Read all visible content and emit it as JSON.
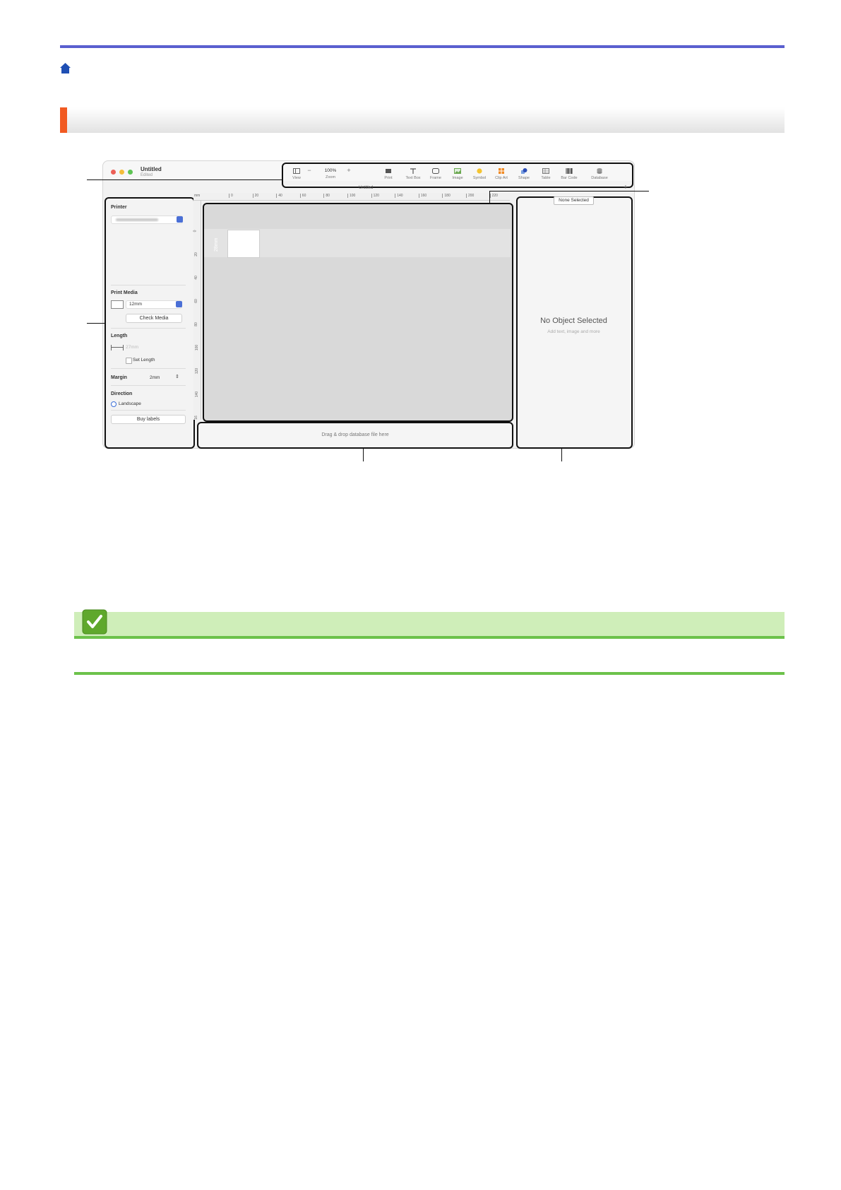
{
  "window": {
    "title": "Untitled",
    "subtitle": "Edited",
    "doc_tab": "Untitled",
    "plus": "+"
  },
  "toolbar": [
    {
      "name": "view",
      "label": "View"
    },
    {
      "name": "zoom-out",
      "label": "−"
    },
    {
      "name": "zoom",
      "label": "Zoom",
      "value": "100%"
    },
    {
      "name": "zoom-in",
      "label": "+"
    },
    {
      "name": "print",
      "label": "Print"
    },
    {
      "name": "text-box",
      "label": "Text Box"
    },
    {
      "name": "frame",
      "label": "Frame"
    },
    {
      "name": "image",
      "label": "Image"
    },
    {
      "name": "symbol",
      "label": "Symbol"
    },
    {
      "name": "clip-art",
      "label": "Clip Art"
    },
    {
      "name": "shape",
      "label": "Shape"
    },
    {
      "name": "table",
      "label": "Table"
    },
    {
      "name": "bar-code",
      "label": "Bar Code"
    },
    {
      "name": "database",
      "label": "Database"
    }
  ],
  "left_panel": {
    "printer_label": "Printer",
    "print_media_label": "Print Media",
    "media_value": "12mm",
    "check_media": "Check Media",
    "length_label": "Length",
    "length_value": "27mm",
    "set_length": "Set Length",
    "margin_label": "Margin",
    "margin_value": "2mm",
    "direction_label": "Direction",
    "landscape": "Landscape",
    "buy_labels": "Buy labels"
  },
  "ruler": {
    "unit": "mm",
    "top_ticks": [
      "0",
      "20",
      "40",
      "60",
      "80",
      "100",
      "120",
      "140",
      "160",
      "180",
      "200",
      "220"
    ],
    "left_ticks": [
      "0",
      "20",
      "40",
      "60",
      "80",
      "100",
      "120",
      "140",
      "16"
    ]
  },
  "canvas": {
    "label_dimension": "28mm"
  },
  "database_bar": {
    "text": "Drag & drop database file here"
  },
  "right_panel": {
    "badge": "None Selected",
    "title": "No Object Selected",
    "subtitle": "Add text, image and more"
  },
  "colors": {
    "accent": "#f15a22",
    "rule": "#5a5fcf",
    "note": "#6cc24a"
  }
}
